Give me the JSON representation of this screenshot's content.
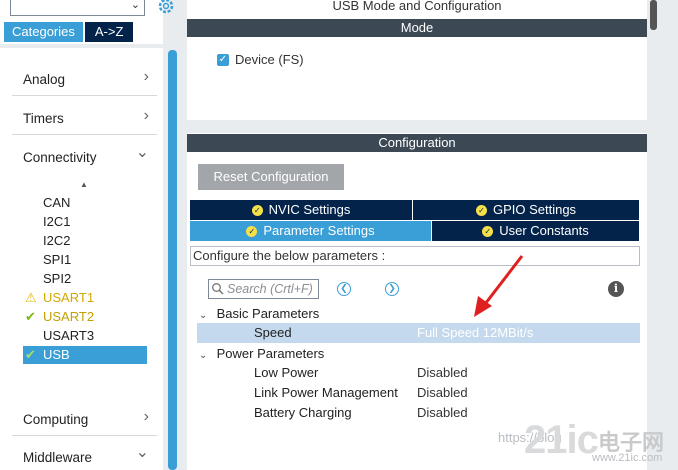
{
  "sidebar": {
    "tabs": {
      "categories": "Categories",
      "atoz": "A->Z"
    },
    "sections": [
      {
        "label": "Analog"
      },
      {
        "label": "Timers"
      },
      {
        "label": "Connectivity"
      },
      {
        "label": "Computing"
      },
      {
        "label": "Middleware"
      }
    ],
    "peripherals": [
      {
        "label": "CAN",
        "status": "none"
      },
      {
        "label": "I2C1",
        "status": "none"
      },
      {
        "label": "I2C2",
        "status": "none"
      },
      {
        "label": "SPI1",
        "status": "none"
      },
      {
        "label": "SPI2",
        "status": "none"
      },
      {
        "label": "USART1",
        "status": "warning"
      },
      {
        "label": "USART2",
        "status": "ok"
      },
      {
        "label": "USART3",
        "status": "none"
      },
      {
        "label": "USB",
        "status": "ok-selected"
      }
    ]
  },
  "mode_pane": {
    "title": "USB Mode and Configuration",
    "header": "Mode",
    "device_label": "Device (FS)",
    "device_checked": true
  },
  "config_pane": {
    "header": "Configuration",
    "reset_label": "Reset Configuration",
    "tabs_row1": [
      "NVIC Settings",
      "GPIO Settings"
    ],
    "tabs_row2": [
      "Parameter Settings",
      "User Constants"
    ],
    "note": "Configure the below parameters :",
    "search_placeholder": "Search (Crtl+F)",
    "groups": [
      {
        "name": "Basic Parameters",
        "params": [
          {
            "name": "Speed",
            "value": "Full Speed 12MBit/s"
          }
        ]
      },
      {
        "name": "Power Parameters",
        "params": [
          {
            "name": "Low Power",
            "value": "Disabled"
          },
          {
            "name": "Link Power Management",
            "value": "Disabled"
          },
          {
            "name": "Battery Charging",
            "value": "Disabled"
          }
        ]
      }
    ]
  },
  "watermark": {
    "text": "https://blog",
    "logo": "21ic",
    "cn": "电子网",
    "url": "www.21ic.com"
  },
  "colors": {
    "accent": "#3a9fd6",
    "navy": "#03234b",
    "band": "#3c4955",
    "arrow": "#e02020"
  }
}
